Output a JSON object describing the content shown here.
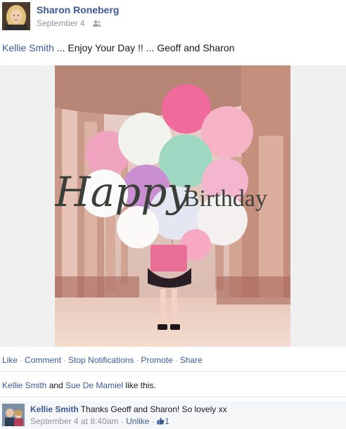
{
  "post": {
    "author_name": "Sharon Roneberg",
    "date": "September 4",
    "privacy_icon": "friends-icon",
    "mention": "Kellie Smith",
    "message": " ... Enjoy Your Day !! ... Geoff and Sharon"
  },
  "photo": {
    "overlay_script": "Happy",
    "overlay_text": "Birthday"
  },
  "actions": {
    "like": "Like",
    "comment": "Comment",
    "stop_notifications": "Stop Notifications",
    "promote": "Promote",
    "share": "Share",
    "separator": "·"
  },
  "likes": {
    "user1": "Kellie Smith",
    "conj": " and ",
    "user2": "Sue De Mamiel",
    "suffix": " like this."
  },
  "comment": {
    "author": "Kellie Smith",
    "text": "Thanks Geoff and Sharon! So lovely xx",
    "time": "September 4 at 8:40am",
    "separator": "·",
    "unlike": "Unlike",
    "like_count": "1"
  },
  "colors": {
    "link": "#3b5998",
    "meta": "#90949c",
    "text": "#141823"
  }
}
